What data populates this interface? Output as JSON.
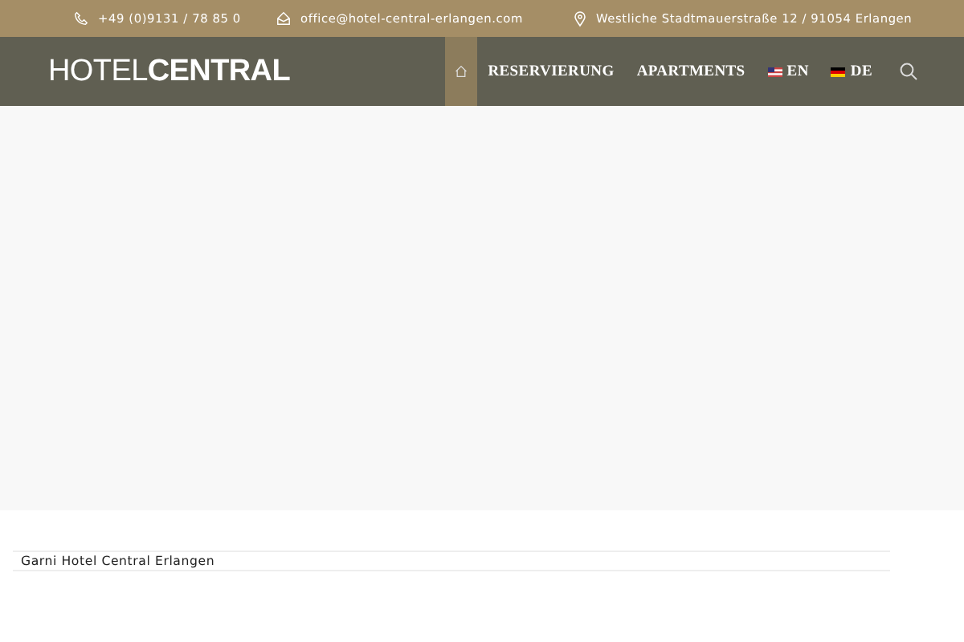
{
  "top_bar": {
    "phone": "+49 (0)9131 / 78 85 0",
    "email": "office@hotel-central-erlangen.com",
    "address": "Westliche Stadtmauerstraße 12 / 91054 Erlangen"
  },
  "header": {
    "logo": "HOTEL**CENTRAL**",
    "nav": [
      {
        "kind": "home",
        "selected": true
      },
      {
        "kind": "text",
        "label": "RESERVIERUNG",
        "selected": false
      },
      {
        "kind": "text",
        "label": "APARTMENTS",
        "selected": false
      },
      {
        "kind": "us",
        "label": "EN",
        "selected": false
      },
      {
        "kind": "de",
        "label": "DE",
        "selected": false
      },
      {
        "kind": "search",
        "selected": false
      }
    ]
  },
  "content": {
    "heading": "Garni Hotel Central Erlangen"
  }
}
